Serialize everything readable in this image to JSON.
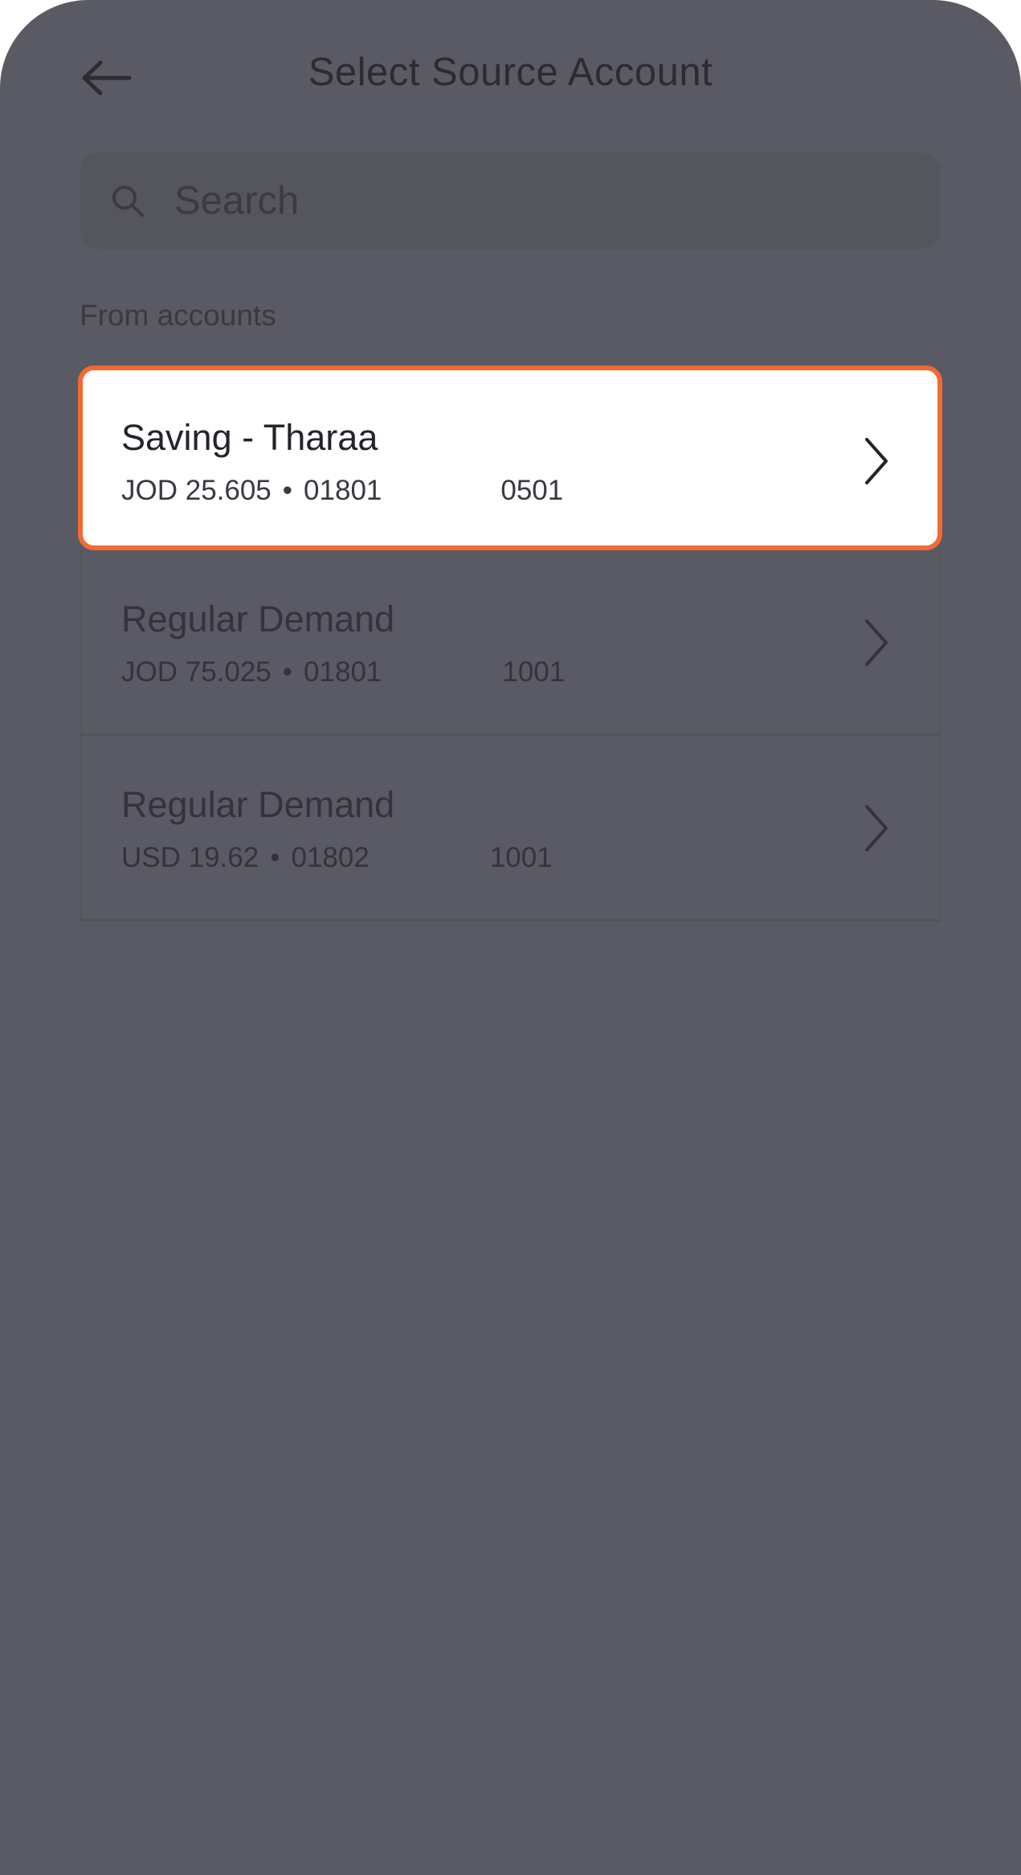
{
  "header": {
    "title": "Select Source Account",
    "back_icon": "arrow-left-icon"
  },
  "search": {
    "placeholder": "Search",
    "icon": "search-icon"
  },
  "section_label": "From accounts",
  "accounts": [
    {
      "name": "Saving - Tharaa",
      "balance": "JOD 25.605",
      "branch": "01801",
      "account_suffix": "0501",
      "selected": true
    },
    {
      "name": "Regular Demand",
      "balance": "JOD 75.025",
      "branch": "01801",
      "account_suffix": "1001",
      "selected": false
    },
    {
      "name": "Regular Demand",
      "balance": "USD 19.62",
      "branch": "01802",
      "account_suffix": "1001",
      "selected": false
    }
  ],
  "colors": {
    "background": "#5a5a64",
    "selected_border": "#f26a33",
    "selected_background": "#ffffff",
    "text_dark": "#2c2b34"
  }
}
